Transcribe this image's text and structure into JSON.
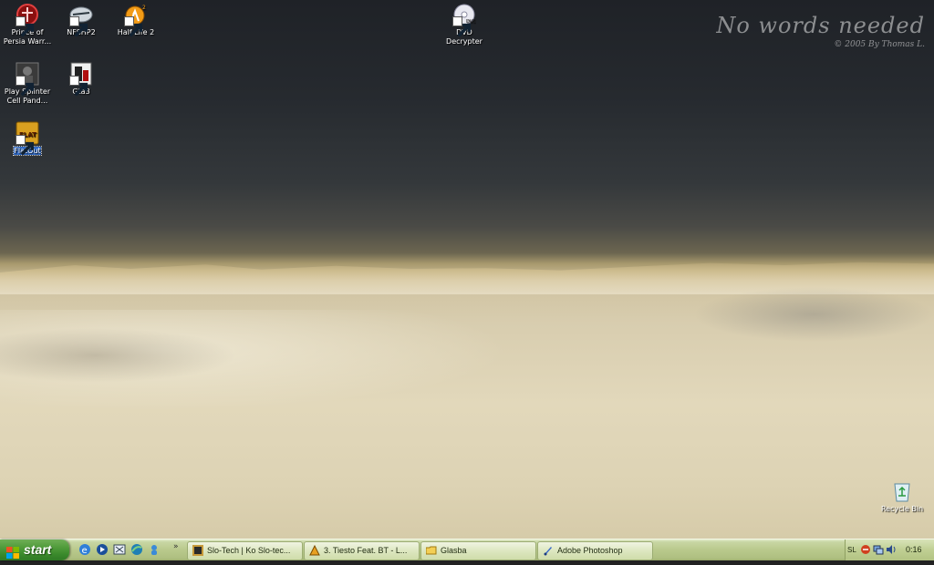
{
  "desktop": {
    "watermark": {
      "line1": "No words needed",
      "line2": "© 2005 By Thomas L."
    },
    "icons": [
      {
        "label": "Prince of Persia Warr...",
        "icon": "prince-of-persia-icon"
      },
      {
        "label": "NFSHP2",
        "icon": "nfshp2-icon"
      },
      {
        "label": "Half-Life 2",
        "icon": "half-life-icon"
      },
      {
        "label": "DVD Decrypter",
        "icon": "dvd-icon"
      },
      {
        "label": "Play Splinter Cell Pand...",
        "icon": "splinter-cell-icon"
      },
      {
        "label": "Gta3",
        "icon": "gta3-icon"
      },
      {
        "label": "FlatOut",
        "icon": "flatout-icon"
      },
      {
        "label": "Recycle Bin",
        "icon": "recycle-bin-icon"
      }
    ]
  },
  "taskbar": {
    "start_label": "start",
    "quick_launch": [
      "internet-explorer-icon",
      "media-player-icon",
      "show-desktop-icon",
      "browser-icon",
      "messenger-icon"
    ],
    "chevron": "»",
    "tasks": [
      {
        "label": "Slo-Tech | Ko Slo-tec...",
        "icon": "slotech-icon"
      },
      {
        "label": "3. Tiesto Feat. BT - L...",
        "icon": "winamp-icon"
      },
      {
        "label": "Glasba",
        "icon": "folder-icon"
      },
      {
        "label": "Adobe Photoshop",
        "icon": "photoshop-icon"
      }
    ],
    "tray": {
      "lang": "SL",
      "clock": "0:16"
    }
  }
}
